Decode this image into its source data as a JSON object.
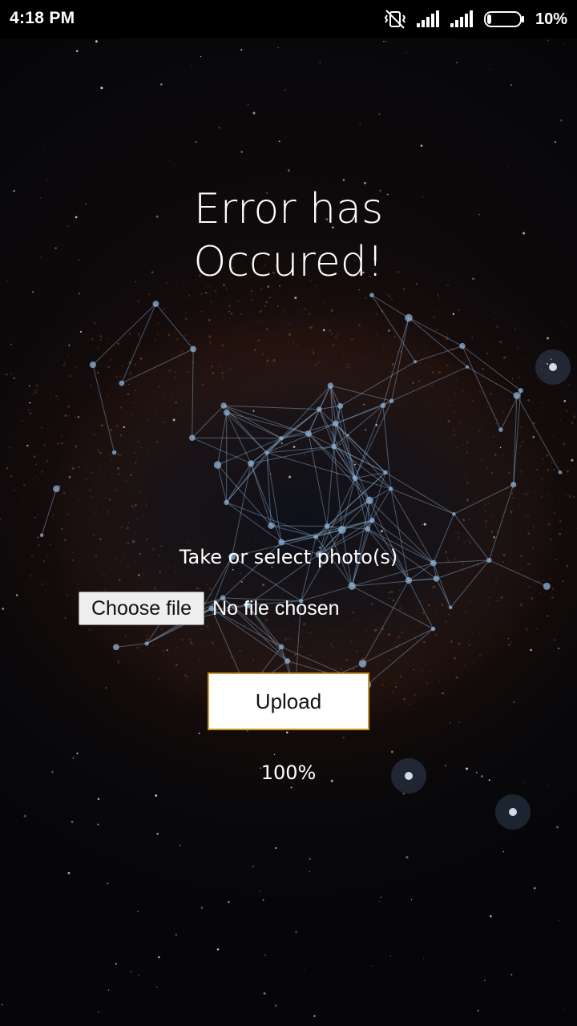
{
  "status_bar": {
    "time": "4:18 PM",
    "battery_percent": "10%",
    "icons": [
      "vibrate-off-icon",
      "signal-icon",
      "signal-icon",
      "battery-icon"
    ]
  },
  "page": {
    "title_line1": "Error has",
    "title_line2": "Occured!",
    "photo_label": "Take or select photo(s)",
    "choose_file_label": "Choose file",
    "file_status": "No file chosen",
    "upload_label": "Upload",
    "progress": "100%"
  },
  "colors": {
    "background": "#060608",
    "nebula_glow": "#82461a",
    "network_lines": "#8fb3d6",
    "upload_border": "#c7962a",
    "text": "#ffffff"
  }
}
